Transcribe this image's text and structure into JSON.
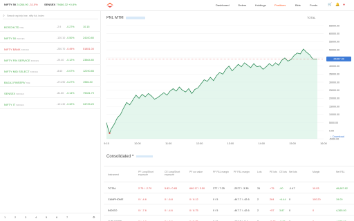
{
  "header": {
    "indices": [
      {
        "name": "NIFTY 50",
        "value": "24266.90",
        "change": "-3.10%",
        "tone": "r"
      },
      {
        "name": "SENSEX",
        "value": "79486.32",
        "change": "+0.8%",
        "tone": "g"
      }
    ],
    "nav": [
      "Dashboard",
      "Orders",
      "Holdings",
      "Positions",
      "Bids",
      "Funds"
    ],
    "active_nav": "Positions",
    "icons": [
      "cart-icon",
      "bell-icon",
      "user-icon"
    ]
  },
  "sidebar": {
    "search_placeholder": "Search eg:infy bse, nifty fut, index",
    "rows": [
      {
        "symbol": "BOSCHLTD",
        "tag": "NSE",
        "change": "-2.9",
        "pct": "-0.27%",
        "ltp": "10.15",
        "tone": "g"
      },
      {
        "symbol": "NIFTY 50",
        "tag": "INDICES",
        "change": "-120.10",
        "pct": "-0.50%",
        "ltp": "24100.80",
        "tone": "g"
      },
      {
        "symbol": "NIFTY BANK",
        "tag": "INDICES",
        "change": "-250.70",
        "pct": "-0.49%",
        "ltp": "51851.00",
        "tone": "r"
      },
      {
        "symbol": "NIFTY FIN SERVICE",
        "tag": "INDICES",
        "change": "-29.40",
        "pct": "-0.12%",
        "ltp": "23864.80",
        "tone": "g"
      },
      {
        "symbol": "NIFTY MID SELECT",
        "tag": "INDICES",
        "change": "-8.60",
        "pct": "-0.07%",
        "ltp": "12290.85",
        "tone": "g"
      },
      {
        "symbol": "BAJAJ-FINSERV",
        "tag": "NSE",
        "change": "-274.90",
        "pct": "-0.27%",
        "ltp": "1966.30",
        "tone": "g"
      },
      {
        "symbol": "SENSEX",
        "tag": "INDICES",
        "change": "-81.60",
        "pct": "-0.14%",
        "ltp": "79281.79",
        "tone": "g"
      },
      {
        "symbol": "NIFTY IT",
        "tag": "INDICES",
        "change": "-121.30",
        "pct": "-0.32%",
        "ltp": "34725.20",
        "tone": "g"
      }
    ],
    "pages": [
      "1",
      "2",
      "3",
      "4",
      "5",
      "6",
      "7"
    ]
  },
  "chart_header": {
    "title": "PNL MTM",
    "total_label": "TOTAL"
  },
  "chart_data": {
    "type": "area",
    "x_ticks": [
      "9:15",
      "10:00",
      "11:00",
      "12:00",
      "13:00",
      "14:00",
      "15:00",
      "16:00"
    ],
    "y_ticks": [
      "65000.00",
      "60000.00",
      "55000.00",
      "50000.00",
      "45000.00",
      "40000.00",
      "35000.00",
      "30000.00",
      "25000.00",
      "20000.00",
      "15000.00",
      "10000.00",
      "5000.00",
      "0.00",
      "-5000.00"
    ],
    "ylim": [
      -5000,
      65000
    ],
    "current_value": "44357.00",
    "points": [
      [
        0,
        5000
      ],
      [
        0.05,
        1500
      ],
      [
        0.1,
        -1500
      ],
      [
        0.15,
        1000
      ],
      [
        0.25,
        4000
      ],
      [
        0.35,
        8000
      ],
      [
        0.45,
        10000
      ],
      [
        0.55,
        14000
      ],
      [
        0.65,
        17500
      ],
      [
        0.75,
        16000
      ],
      [
        0.85,
        19000
      ],
      [
        0.95,
        22000
      ],
      [
        1.05,
        20000
      ],
      [
        1.15,
        22500
      ],
      [
        1.25,
        21000
      ],
      [
        1.35,
        23000
      ],
      [
        1.45,
        21500
      ],
      [
        1.55,
        19500
      ],
      [
        1.65,
        20500
      ],
      [
        1.75,
        22000
      ],
      [
        1.85,
        23500
      ],
      [
        1.95,
        22000
      ],
      [
        2.05,
        24500
      ],
      [
        2.15,
        26000
      ],
      [
        2.25,
        24500
      ],
      [
        2.35,
        27000
      ],
      [
        2.45,
        25000
      ],
      [
        2.55,
        24000
      ],
      [
        2.65,
        26000
      ],
      [
        2.75,
        23000
      ],
      [
        2.85,
        25500
      ],
      [
        2.95,
        26500
      ],
      [
        3.05,
        29000
      ],
      [
        3.15,
        31500
      ],
      [
        3.25,
        30500
      ],
      [
        3.35,
        33000
      ],
      [
        3.45,
        31000
      ],
      [
        3.55,
        34000
      ],
      [
        3.65,
        36000
      ],
      [
        3.75,
        35000
      ],
      [
        3.85,
        38000
      ],
      [
        3.95,
        40000
      ],
      [
        4.05,
        37000
      ],
      [
        4.15,
        39000
      ],
      [
        4.25,
        41000
      ],
      [
        4.35,
        39500
      ],
      [
        4.45,
        42000
      ],
      [
        4.55,
        40500
      ],
      [
        4.65,
        39000
      ],
      [
        4.75,
        41500
      ],
      [
        4.85,
        39500
      ],
      [
        4.95,
        40000
      ],
      [
        5.05,
        38000
      ],
      [
        5.15,
        39500
      ],
      [
        5.25,
        41500
      ],
      [
        5.35,
        40000
      ],
      [
        5.45,
        42000
      ],
      [
        5.55,
        40500
      ],
      [
        5.65,
        43500
      ],
      [
        5.75,
        45000
      ],
      [
        5.85,
        43000
      ],
      [
        5.95,
        44000
      ],
      [
        6.05,
        46500
      ],
      [
        6.15,
        48000
      ],
      [
        6.25,
        47500
      ],
      [
        6.35,
        50500
      ],
      [
        6.45,
        48500
      ],
      [
        6.55,
        47000
      ],
      [
        6.65,
        44400
      ],
      [
        6.8,
        44357
      ]
    ]
  },
  "consolidated": {
    "title": "Consolidated",
    "download_label": "Download",
    "columns": [
      "Instrument",
      "PF Long/Short exposure",
      "CE Long/Short exposure",
      "PF cur value",
      "PF P&L margin",
      "PF P&L margin",
      "Lots",
      "PE lots",
      "CE lots",
      "Net lots",
      "Margin",
      "Net P&L"
    ],
    "rows": [
      {
        "instrument": "TOTAL",
        "c1": "2.75 / -2.70",
        "c2": "5.83 / 0.83",
        "c3": "660.17 / 3.50",
        "c4": "277 / 7.25",
        "c5": "-2577 / -3.35",
        "c6": "31",
        "c7": "+75",
        "c8": "-90",
        "c9": "-1.47",
        "c10": "10.03",
        "c11": "46,687.62"
      },
      {
        "instrument": "CAMPHOME",
        "c1": "0 / -4.6",
        "c2": "0 / -6.8",
        "c3": "0 / 8.12",
        "c4": "0 / 5",
        "c5": "-447.7 / -42.6",
        "c6": "2",
        "c7": "264",
        "c8": "+4.44",
        "c9": "0",
        "c10": "100.20",
        "c11": "19.00"
      },
      {
        "instrument": "INDIGO",
        "c1": "0 / -7.6",
        "c2": "0 / -4.6",
        "c3": "0 / 8.75",
        "c4": "0 / 5",
        "c5": "-447.7 / -42.6",
        "c6": "2",
        "c7": "+57",
        "c8": "3.87",
        "c9": "0",
        "c10": "0",
        "c11": "4,365.00"
      },
      {
        "instrument": "JUBLFOOD",
        "c1": "0 / -4.6",
        "c2": "0 / -6.6",
        "c3": "0 / 5.75",
        "c4": "0 / 5",
        "c5": "-151.7 / -3.4",
        "c6": "2",
        "c7": "-5.85",
        "c8": "-5.85",
        "c9": "0",
        "c10": "0",
        "c11": "4,375.00"
      }
    ]
  },
  "colors": {
    "accent": "#ff5722",
    "positive": "#4caf50",
    "negative": "#e05050",
    "line": "#2e8b57",
    "fill": "#d9f2e6"
  }
}
